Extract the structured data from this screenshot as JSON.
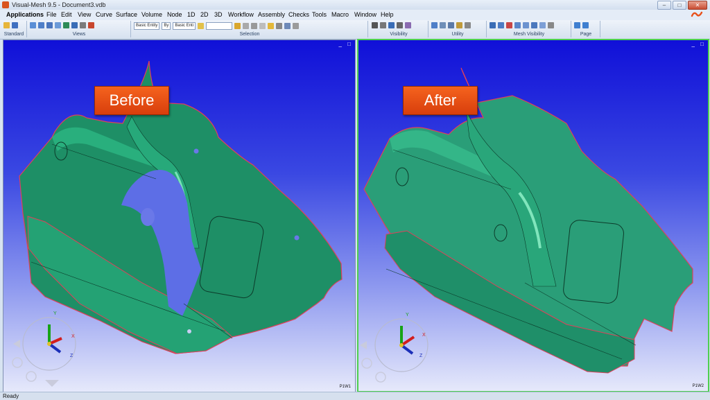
{
  "window": {
    "title": "Visual-Mesh 9.5 - Document3.vdb",
    "buttons": [
      "–",
      "□",
      "✕"
    ]
  },
  "menu": [
    "Applications",
    "File",
    "Edit",
    "View",
    "Curve",
    "Surface",
    "Volume",
    "Node",
    "1D",
    "2D",
    "3D",
    "Workflow",
    "Assembly",
    "Checks",
    "Tools",
    "Macro",
    "Window",
    "Help"
  ],
  "toolbar": {
    "groups": [
      "Standard",
      "Views",
      "Selection",
      "Visibility",
      "Utility",
      "Mesh Visibility",
      "Page"
    ],
    "entity_select_1": "Basic Entity",
    "by_select": "By",
    "entity_select_2": "Basic Enti"
  },
  "viewports": {
    "left": {
      "callout": "Before",
      "name": "P1W1",
      "controls": "_ □"
    },
    "right": {
      "callout": "After",
      "name": "P1W2",
      "controls": "_ □"
    },
    "axis_labels": {
      "x": "X",
      "y": "Y",
      "z": "Z"
    }
  },
  "colors": {
    "accent": "#e8501a",
    "part_green": "#1f9a6e",
    "highlight_border": "#4ed04e",
    "edge_red": "#e0405a"
  },
  "status": {
    "text": "Ready"
  }
}
